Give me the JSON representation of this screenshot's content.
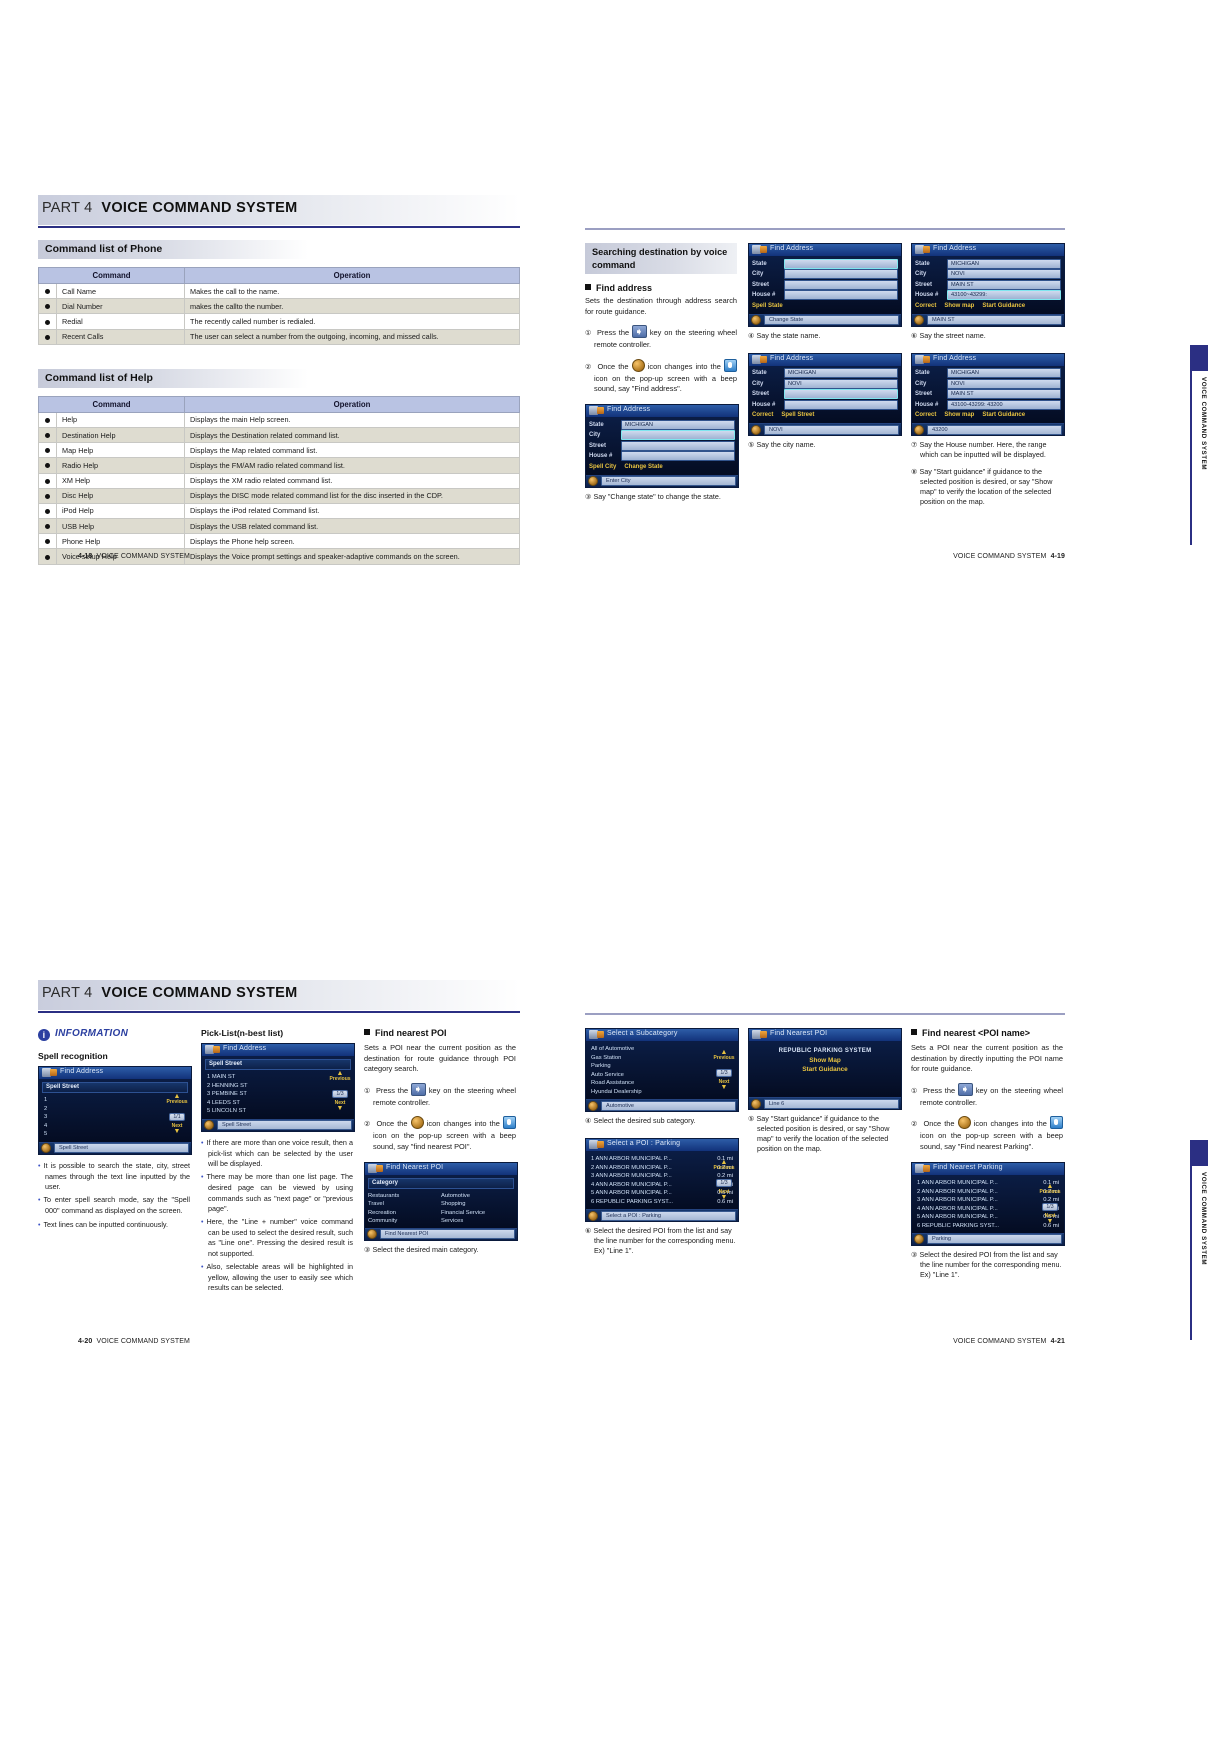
{
  "part_header": {
    "part_label": "PART 4",
    "title": "VOICE COMMAND SYSTEM"
  },
  "side_tab": {
    "label": "VOICE COMMAND SYSTEM"
  },
  "page_4_18": {
    "footer": {
      "number": "4-18",
      "title": "VOICE COMMAND SYSTEM"
    },
    "phone_section": {
      "heading": "Command list of Phone",
      "columns": [
        "Command",
        "Operation"
      ],
      "rows": [
        {
          "command": "Call Name",
          "operation": "Makes the call to the name."
        },
        {
          "command": "Dial Number",
          "operation": "makes the callto the number."
        },
        {
          "command": "Redial",
          "operation": "The recently called number is redialed."
        },
        {
          "command": "Recent Calls",
          "operation": "The user can select a number from the outgoing, incoming, and missed calls."
        }
      ]
    },
    "help_section": {
      "heading": "Command list of Help",
      "columns": [
        "Command",
        "Operation"
      ],
      "rows": [
        {
          "command": "Help",
          "operation": "Displays the main Help screen."
        },
        {
          "command": "Destination Help",
          "operation": "Displays the Destination related command list."
        },
        {
          "command": "Map Help",
          "operation": "Displays the Map related command list."
        },
        {
          "command": "Radio Help",
          "operation": "Displays the FM/AM radio related command list."
        },
        {
          "command": "XM Help",
          "operation": "Displays the XM radio related command list."
        },
        {
          "command": "Disc Help",
          "operation": "Displays the DISC mode related command list for the disc inserted in the CDP."
        },
        {
          "command": "iPod Help",
          "operation": "Displays the iPod related Command list."
        },
        {
          "command": "USB Help",
          "operation": "Displays the USB related command list."
        },
        {
          "command": "Phone Help",
          "operation": "Displays the Phone help screen."
        },
        {
          "command": "Voice setup Help",
          "operation": "Displays the Voice prompt settings and speaker-adaptive commands on the screen."
        }
      ]
    }
  },
  "page_4_19": {
    "footer": {
      "title": "VOICE COMMAND SYSTEM",
      "number": "4-19"
    },
    "section_title": "Searching destination by voice command",
    "find_address": {
      "subhead": "Find address",
      "intro": "Sets the destination through address search for route guidance.",
      "step1": "Press the",
      "step1_tail": "key on the steering wheel remote controller.",
      "step2_a": "Once the",
      "step2_b": "icon changes into the",
      "step2_c": "icon on the pop-up screen with a beep sound, say \"Find address\".",
      "cap3": "Say \"Change state\" to change the state.",
      "cap4": "Say the state name.",
      "cap5": "Say the city name.",
      "cap6": "Say the street name.",
      "cap7": "Say the House number. Here, the range which can be inputted will be displayed.",
      "cap8": "Say \"Start guidance\" if guidance to the selected position is desired, or say \"Show map\" to verify the location of the selected position on the map."
    },
    "screens": {
      "blank": {
        "title": "Find Address",
        "labels": [
          "State",
          "City",
          "Street",
          "House #"
        ],
        "values": [
          "",
          "",
          "",
          ""
        ],
        "menu": [
          "Spell State"
        ],
        "footer_value": "Change State"
      },
      "state_filled": {
        "title": "Find Address",
        "labels": [
          "State",
          "City",
          "Street",
          "House #"
        ],
        "values": [
          "MICHIGAN",
          "",
          "",
          ""
        ],
        "menu": [
          "Spell City",
          "Change State"
        ],
        "footer_value": "Enter City"
      },
      "city_filled": {
        "title": "Find Address",
        "labels": [
          "State",
          "City",
          "Street",
          "House #"
        ],
        "values": [
          "MICHIGAN",
          "NOVI",
          "",
          ""
        ],
        "menu": [
          "Correct",
          "Spell Street"
        ],
        "footer_value": "NOVI"
      },
      "street_filled": {
        "title": "Find Address",
        "labels": [
          "State",
          "City",
          "Street",
          "House #"
        ],
        "values": [
          "MICHIGAN",
          "NOVI",
          "MAIN ST",
          "43100~43299:"
        ],
        "menu": [
          "Correct",
          "Show map",
          "Start Guidance"
        ],
        "footer_value": "MAIN ST"
      },
      "house_filled": {
        "title": "Find Address",
        "labels": [
          "State",
          "City",
          "Street",
          "House #"
        ],
        "values": [
          "MICHIGAN",
          "NOVI",
          "MAIN ST",
          "43100-43299: 43200"
        ],
        "menu": [
          "Correct",
          "Show map",
          "Start Guidance"
        ],
        "footer_value": "43200"
      }
    }
  },
  "page_4_20": {
    "footer": {
      "number": "4-20",
      "title": "VOICE COMMAND SYSTEM"
    },
    "information": {
      "badge": "i",
      "title": "INFORMATION",
      "subtitle": "Spell recognition",
      "bullets": [
        "It is possible to search the state, city, street names through the text line inputted by the user.",
        "To enter spell search mode, say the \"Spell 000\" command as displayed on the screen.",
        "Text lines can be inputted continuously."
      ],
      "screen": {
        "title": "Find Address",
        "banner": "Spell Street",
        "rows": [
          "1",
          "2",
          "3",
          "4",
          "5"
        ],
        "previous": "Previous",
        "page": "1/1",
        "next": "Next",
        "footer_value": "Spell Street"
      }
    },
    "picklist": {
      "heading": "Pick-List(n-best list)",
      "screen": {
        "title": "Find Address",
        "banner": "Spell Street",
        "rows": [
          "1 MAIN ST",
          "2 HENNING ST",
          "3 PEMBINE ST",
          "4 LEEDS ST",
          "5 LINCOLN ST"
        ],
        "previous": "Previous",
        "page": "1/3",
        "next": "Next",
        "footer_value": "Spell Street"
      },
      "bullets": [
        "If there are more than one voice result, then a pick-list which can be selected by the user will be displayed.",
        "There may be more than one list page. The desired page can be viewed by using commands such as \"next page\" or \"previous page\".",
        "Here, the \"Line + number\" voice command can be used to select the desired result, such as \"Line one\". Pressing the desired result is not supported.",
        "Also, selectable areas will be highlighted in yellow, allowing the user to easily see which results can be selected."
      ]
    },
    "find_nearest_poi": {
      "subhead": "Find nearest POI",
      "intro": "Sets a POI near the current position as the destination for route guidance through POI category search.",
      "step1": "Press the",
      "step1_tail": "key on the steering wheel remote controller.",
      "step2_a": "Once the",
      "step2_b": "icon changes into the",
      "step2_c": "icon on the pop-up screen with a beep sound, say \"find nearest POI\".",
      "cap3": "Select the desired main category.",
      "screen": {
        "title": "Find Nearest POI",
        "banner": "Category",
        "col_left": [
          "Restaurants",
          "Travel",
          "Recreation",
          "Community"
        ],
        "col_right": [
          "Automotive",
          "Shopping",
          "Financial Service",
          "Services"
        ],
        "footer_value": "Find Nearest POI"
      }
    }
  },
  "page_4_21": {
    "footer": {
      "title": "VOICE COMMAND SYSTEM",
      "number": "4-21"
    },
    "subcategory": {
      "screen": {
        "title": "Select a Subcategory",
        "rows": [
          "All of Automotive",
          "Gas Station",
          "Parking",
          "Auto Service",
          "Road Assistance",
          "Hyundai Dealership"
        ],
        "previous": "Previous",
        "page": "1/3",
        "next": "Next",
        "footer_value": "Automotive"
      },
      "cap4": "Select the desired sub category."
    },
    "poi_list": {
      "screen": {
        "title": "Select a POI : Parking",
        "rows": [
          {
            "name": "1 ANN ARBOR MUNICIPAL P...",
            "dist": "0.1 mi"
          },
          {
            "name": "2 ANN ARBOR MUNICIPAL P...",
            "dist": "0.2 mi"
          },
          {
            "name": "3 ANN ARBOR MUNICIPAL P...",
            "dist": "0.2 mi"
          },
          {
            "name": "4 ANN ARBOR MUNICIPAL P...",
            "dist": "0.5 mi"
          },
          {
            "name": "5 ANN ARBOR MUNICIPAL P...",
            "dist": "0.6 mi"
          },
          {
            "name": "6 REPUBLIC PARKING SYST...",
            "dist": "0.6 mi"
          }
        ],
        "previous": "Previous",
        "page": "1/3",
        "next": "Next",
        "footer_value": "Select a POI : Parking"
      },
      "cap6": "Select the desired POI from the list and say the line number for the corresponding menu. Ex) \"Line 1\"."
    },
    "nearest_poi_result": {
      "screen": {
        "title": "Find Nearest POI",
        "name": "REPUBLIC PARKING SYSTEM",
        "options": [
          "Show Map",
          "Start Guidance"
        ],
        "footer_value": "Line 6"
      },
      "cap5": "Say \"Start guidance\" if guidance to the selected position is desired, or say \"Show map\" to verify the location of the selected position on the map."
    },
    "find_nearest_poi_name": {
      "subhead": "Find nearest <POI name>",
      "intro": "Sets a POI near the current position as the destination by directly inputting the POI name for route guidance.",
      "step1": "Press the",
      "step1_tail": "key on the steering wheel remote controller.",
      "step2_a": "Once the",
      "step2_b": "icon changes into the",
      "step2_c": "icon on the pop-up screen with a beep sound, say \"Find nearest Parking\".",
      "cap3": "Select the desired POI from the list and say the line number for the corresponding menu. Ex) \"Line 1\".",
      "screen": {
        "title": "Find Nearest Parking",
        "rows": [
          {
            "name": "1 ANN ARBOR MUNICIPAL P...",
            "dist": "0.1 mi"
          },
          {
            "name": "2 ANN ARBOR MUNICIPAL P...",
            "dist": "0.2 mi"
          },
          {
            "name": "3 ANN ARBOR MUNICIPAL P...",
            "dist": "0.2 mi"
          },
          {
            "name": "4 ANN ARBOR MUNICIPAL P...",
            "dist": "0.5 mi"
          },
          {
            "name": "5 ANN ARBOR MUNICIPAL P...",
            "dist": "0.6 mi"
          },
          {
            "name": "6 REPUBLIC PARKING SYST...",
            "dist": "0.6 mi"
          }
        ],
        "previous": "Previous",
        "page": "1/3",
        "next": "Next",
        "footer_value": "Parking"
      }
    }
  }
}
